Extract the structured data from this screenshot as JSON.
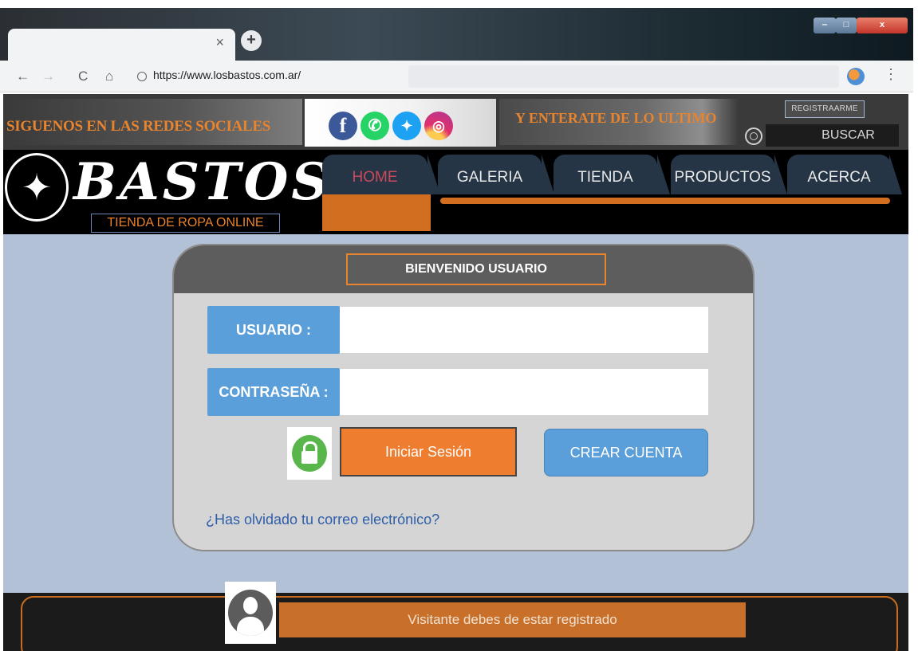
{
  "browser": {
    "url": "https://www.losbastos.com.ar/",
    "tab_close_glyph": "×",
    "new_tab_glyph": "+",
    "icons": {
      "back": "arrow-left-icon",
      "forward": "arrow-right-icon",
      "reload": "reload-icon",
      "home": "home-icon",
      "security": "page-info-icon",
      "extension": "extension-icon",
      "menu": "kebab-menu-icon"
    },
    "glyphs": {
      "back": "←",
      "forward": "→",
      "reload": "C",
      "home": "⌂",
      "menu": "⋮",
      "minimize": "‒",
      "maximize": "□",
      "close": "x"
    }
  },
  "header": {
    "follow_text": "SIGUENOS EN LAS REDES SOCIALES",
    "latest_text": "Y ENTERATE DE LO ULTIMO",
    "register_label": "REGISTRAARME",
    "search_placeholder": "BUSCAR",
    "social": [
      {
        "name": "facebook-icon",
        "glyph": "f",
        "color": "#3b5998"
      },
      {
        "name": "whatsapp-icon",
        "glyph": "✆",
        "color": "#25d366"
      },
      {
        "name": "twitter-icon",
        "glyph": "✦",
        "color": "#1da1f2"
      },
      {
        "name": "instagram-icon",
        "glyph": "◎",
        "color": "#e1306c"
      }
    ]
  },
  "brand": {
    "logo_word": "BASTOS",
    "logo_emblem": "lizard-emblem-icon",
    "tagline": "TIENDA DE ROPA ONLINE"
  },
  "nav": {
    "active": "HOME",
    "items": [
      "HOME",
      "GALERIA",
      "TIENDA",
      "PRODUCTOS",
      "ACERCA"
    ]
  },
  "login": {
    "title": "BIENVENIDO USUARIO",
    "user_label": "USUARIO :",
    "password_label": "CONTRASEÑA :",
    "user_value": "",
    "password_value": "",
    "login_button": "Iniciar Sesión",
    "create_button": "CREAR CUENTA",
    "forgot_link": "¿Has olvidado tu correo electrónico?"
  },
  "footer": {
    "visitor_message": "Visitante debes de estar registrado"
  },
  "colors": {
    "accent_orange": "#ee7d2f",
    "accent_blue": "#5a9fd9",
    "page_bg": "#b3c1d6",
    "nav_tab": "#253545"
  }
}
